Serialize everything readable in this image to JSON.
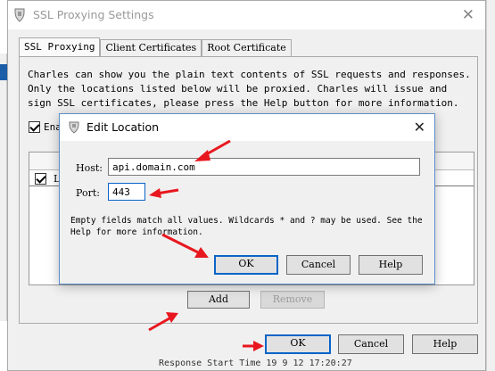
{
  "main_window": {
    "title": "SSL Proxying Settings",
    "close_glyph": "✕",
    "tabs": [
      {
        "label": "SSL Proxying",
        "active": true
      },
      {
        "label": "Client Certificates",
        "active": false
      },
      {
        "label": "Root Certificate",
        "active": false
      }
    ],
    "description": "Charles can show you the plain text contents of SSL requests and responses. Only the locations listed below will be proxied. Charles will issue and sign SSL certificates, please press the Help button for more information.",
    "enable_label": "Ena",
    "enable_checked": true,
    "location_row_checked": true,
    "location_row_label": "L",
    "add_label": "Add",
    "remove_label": "Remove",
    "ok_label": "OK",
    "cancel_label": "Cancel",
    "help_label": "Help"
  },
  "dialog": {
    "title": "Edit Location",
    "close_glyph": "✕",
    "host_label": "Host:",
    "host_value": "api.domain.com",
    "port_label": "Port:",
    "port_value": "443",
    "note": "Empty fields match all values. Wildcards * and ? may be used. See the Help for more information.",
    "ok_label": "OK",
    "cancel_label": "Cancel",
    "help_label": "Help"
  },
  "background": {
    "status_text": "Response Start Time   19 9 12 17:20:27"
  },
  "colors": {
    "annotation_arrow": "#e8171f",
    "focus_border": "#0a64c8",
    "dialog_border": "#5b8fc9"
  }
}
